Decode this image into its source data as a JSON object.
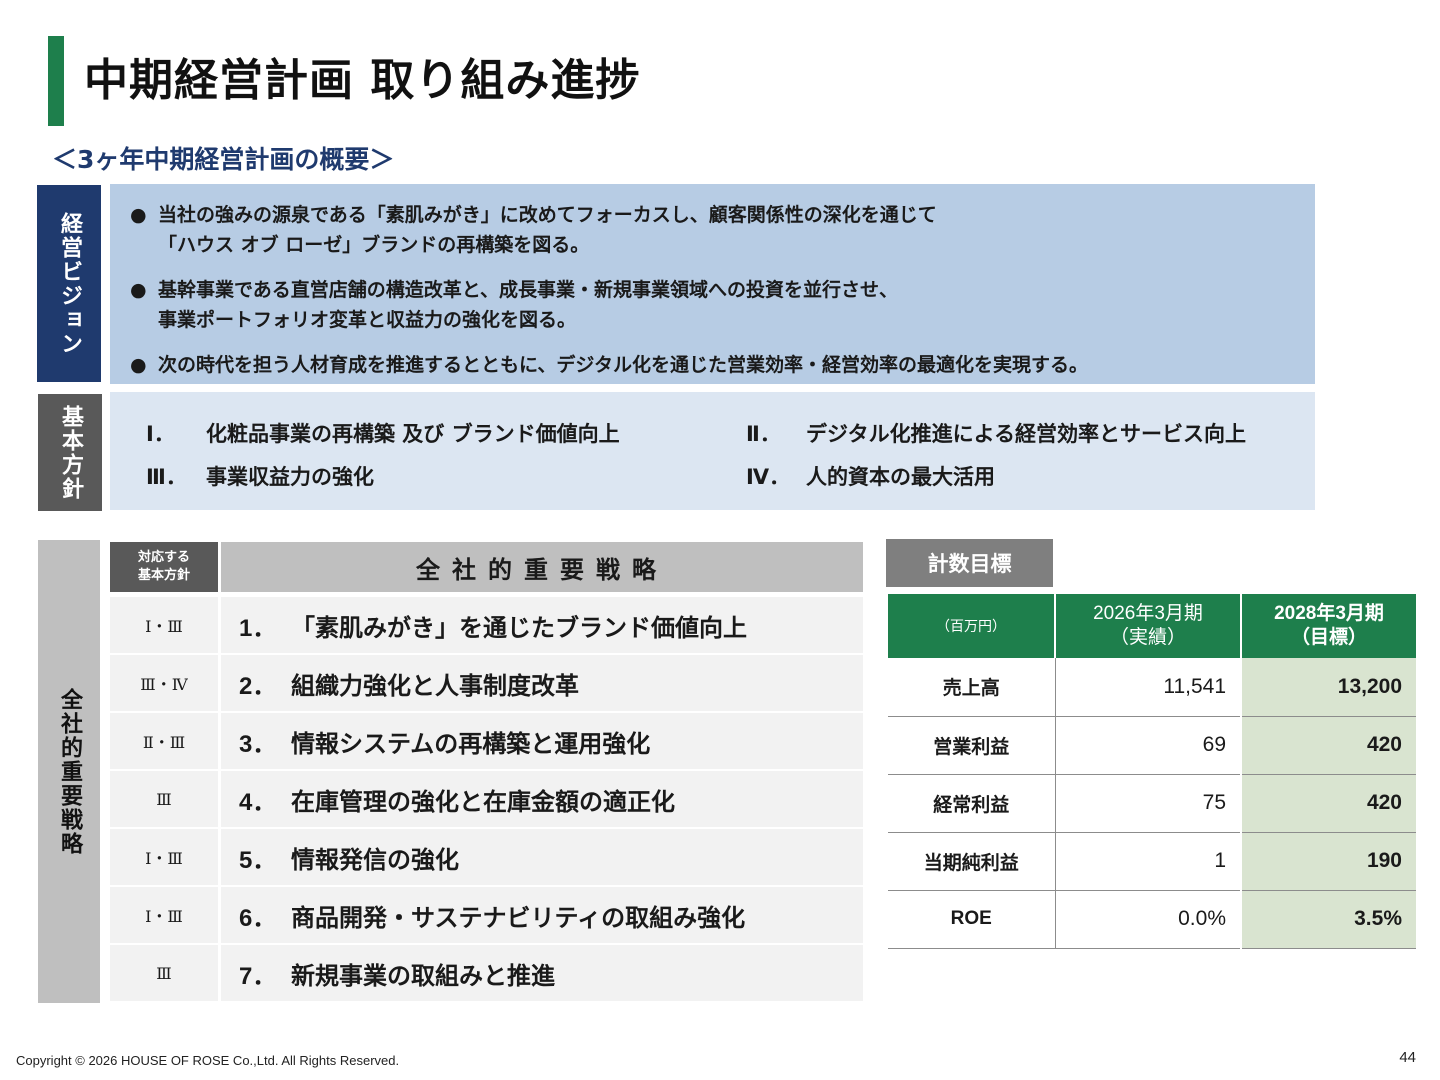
{
  "title": "中期経営計画 取り組み進捗",
  "subtitle": "＜3ヶ年中期経営計画の概要＞",
  "vision": {
    "label": "経営ビジョン",
    "bullet_mark": "●",
    "bullets": [
      {
        "line1": "当社の強みの源泉である「素肌みがき」に改めてフォーカスし、顧客関係性の深化を通じて",
        "line2": "「ハウス オブ ローゼ」ブランドの再構築を図る。"
      },
      {
        "line1": "基幹事業である直営店舗の構造改革と、成長事業・新規事業領域への投資を並行させ、",
        "line2": "事業ポートフォリオ変革と収益力の強化を図る。"
      },
      {
        "line1": "次の時代を担う人材育成を推進するとともに、デジタル化を通じた営業効率・経営効率の最適化を実現する。",
        "line2": ""
      }
    ]
  },
  "policy": {
    "label": "基本方針",
    "items": [
      {
        "num": "Ⅰ．",
        "text": "化粧品事業の再構築 及び ブランド価値向上"
      },
      {
        "num": "Ⅱ．",
        "text": "デジタル化推進による経営効率とサービス向上"
      },
      {
        "num": "Ⅲ．",
        "text": "事業収益力の強化"
      },
      {
        "num": "Ⅳ．",
        "text": "人的資本の最大活用"
      }
    ]
  },
  "strategy": {
    "side_label": "全社的重要戦略",
    "header_policy_line1": "対応する",
    "header_policy_line2": "基本方針",
    "header_title": "全社的重要戦略",
    "rows": [
      {
        "policy": "Ⅰ・Ⅲ",
        "num": "1．",
        "text": "「素肌みがき」を通じたブランド価値向上"
      },
      {
        "policy": "Ⅲ・Ⅳ",
        "num": "2．",
        "text": "組織力強化と人事制度改革"
      },
      {
        "policy": "Ⅱ・Ⅲ",
        "num": "3．",
        "text": "情報システムの再構築と運用強化"
      },
      {
        "policy": "Ⅲ",
        "num": "4．",
        "text": "在庫管理の強化と在庫金額の適正化"
      },
      {
        "policy": "Ⅰ・Ⅲ",
        "num": "5．",
        "text": "情報発信の強化"
      },
      {
        "policy": "Ⅰ・Ⅲ",
        "num": "6．",
        "text": "商品開発・サステナビリティの取組み強化"
      },
      {
        "policy": "Ⅲ",
        "num": "7．",
        "text": "新規事業の取組みと推進"
      }
    ]
  },
  "kpi": {
    "label": "計数目標",
    "unit": "（百万円）",
    "col1_line1": "2026年3月期",
    "col1_line2": "（実績）",
    "col2_line1": "2028年3月期",
    "col2_line2": "（目標）",
    "rows": [
      {
        "name": "売上高",
        "actual": "11,541",
        "target": "13,200"
      },
      {
        "name": "営業利益",
        "actual": "69",
        "target": "420"
      },
      {
        "name": "経常利益",
        "actual": "75",
        "target": "420"
      },
      {
        "name": "当期純利益",
        "actual": "1",
        "target": "190"
      },
      {
        "name": "ROE",
        "actual": "0.0%",
        "target": "3.5%"
      }
    ]
  },
  "footer": {
    "copyright": "Copyright © 2026 HOUSE OF ROSE Co.,Ltd. All Rights Reserved.",
    "page": "44"
  },
  "colors": {
    "accent_green": "#1e7f4c",
    "navy": "#1f3a6e",
    "vision_bg": "#b7cce4",
    "policy_bg": "#dce6f2",
    "target_bg": "#d9e4d0"
  }
}
